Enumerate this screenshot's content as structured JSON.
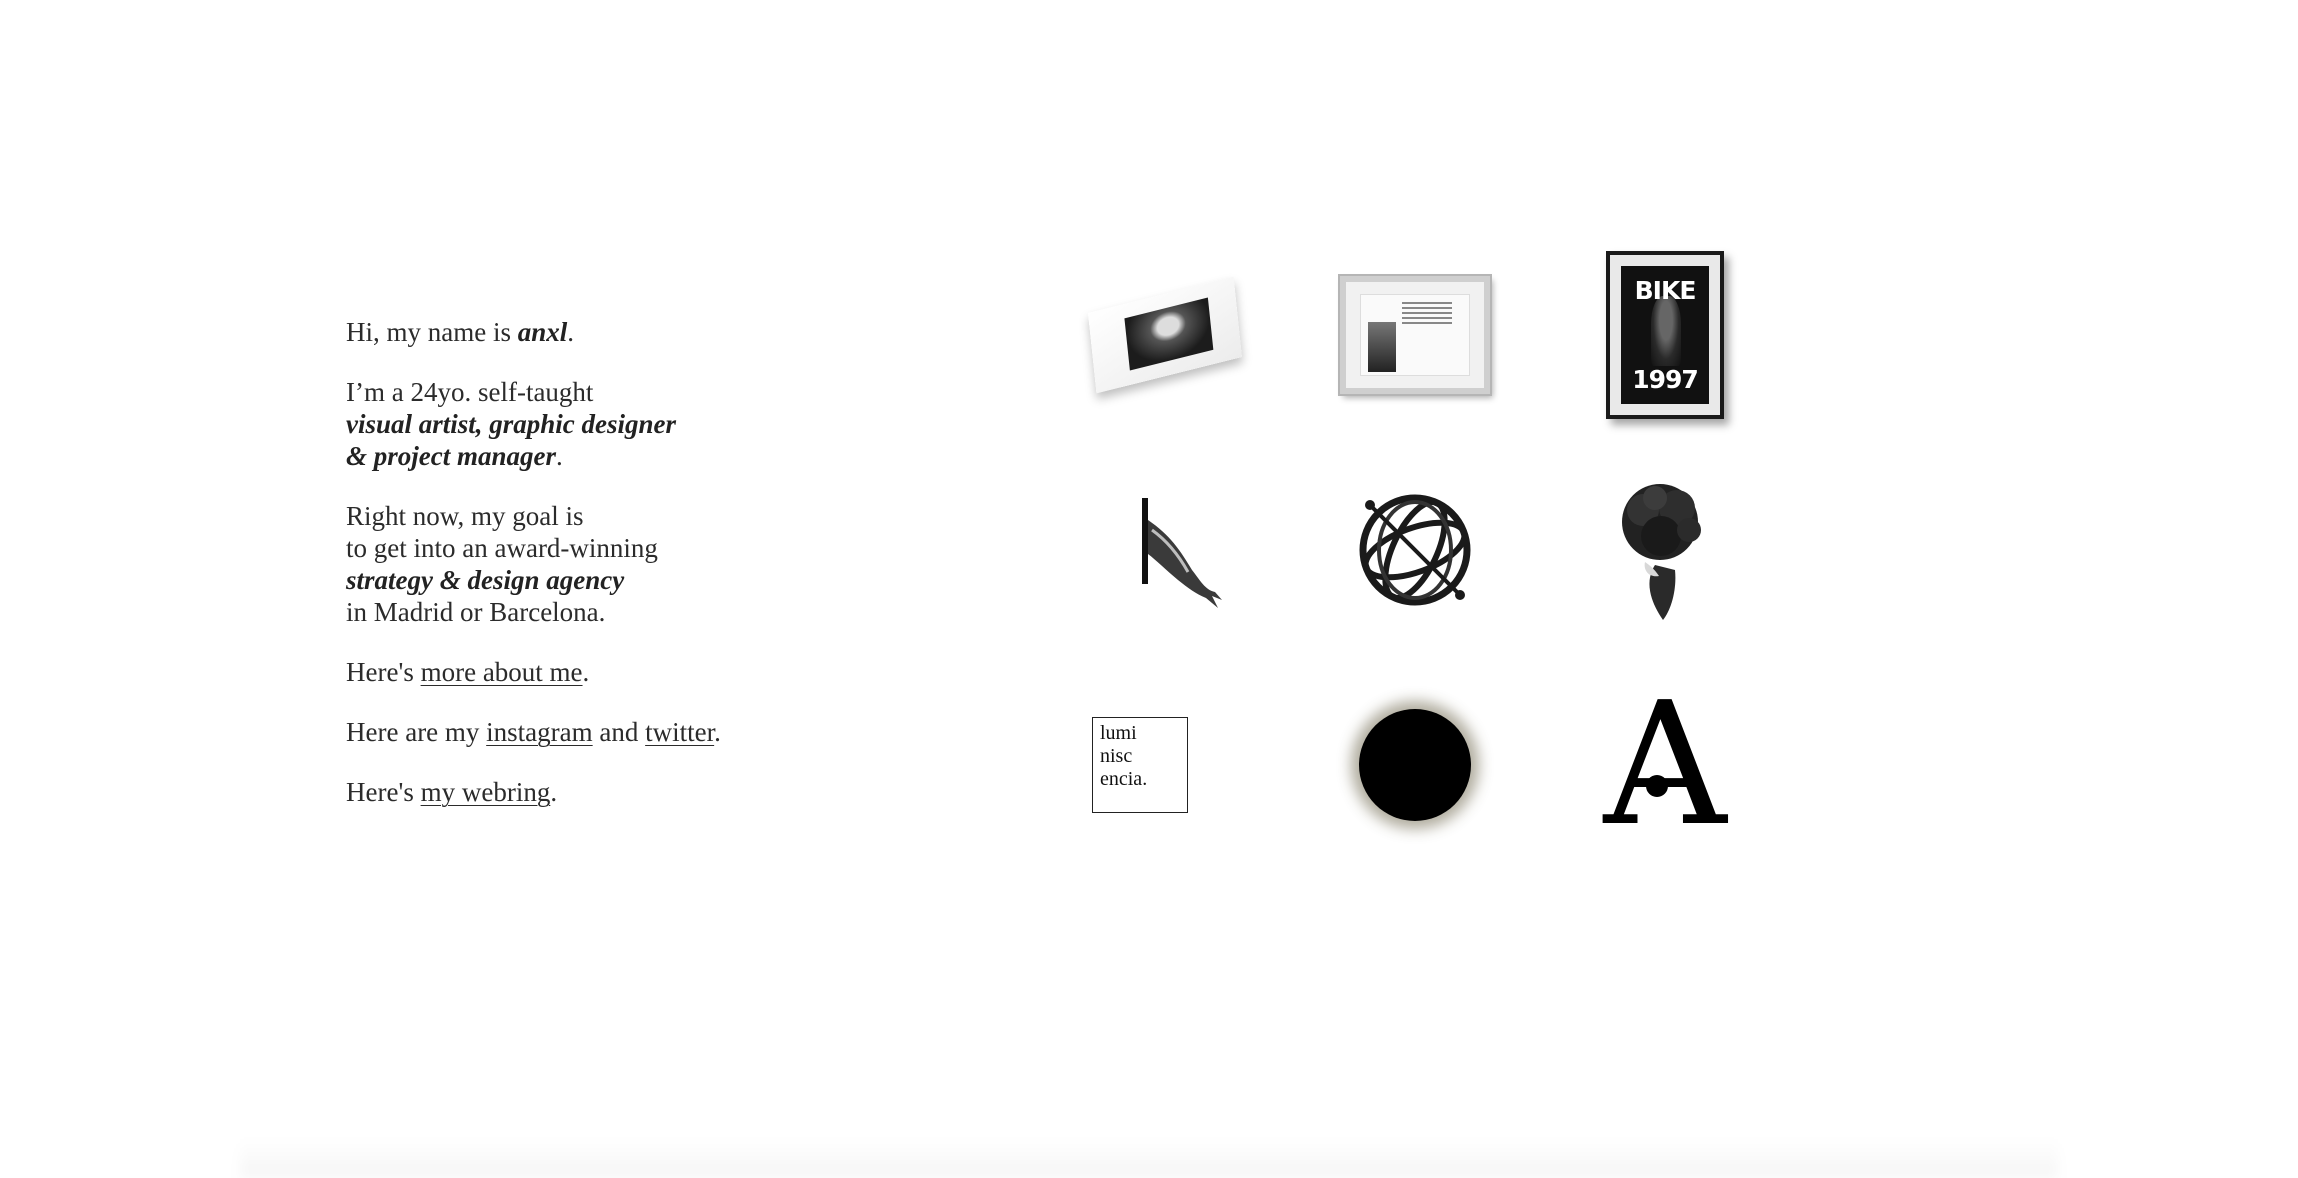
{
  "intro": {
    "greeting_prefix": "Hi, my name is ",
    "name": "anxl",
    "greeting_suffix": ".",
    "about_prefix": "I’m a 24yo. self-taught",
    "role_line1": "visual artist, graphic designer",
    "role_line2": "& project manager",
    "role_suffix": ".",
    "goal_line1": "Right now, my goal is",
    "goal_line2": "to get into an award-winning",
    "goal_emphasis": "strategy & design agency",
    "goal_line3": "in Madrid or Barcelona.",
    "more_prefix": "Here's ",
    "more_link": "more about me",
    "more_suffix": ".",
    "social_prefix": "Here are my ",
    "instagram_link": "instagram",
    "social_and": " and ",
    "twitter_link": "twitter",
    "social_suffix": ".",
    "webring_prefix": "Here's ",
    "webring_link": "my webring",
    "webring_suffix": "."
  },
  "gallery": {
    "items": [
      {
        "id": "print-mockup",
        "icon": "tilted-print"
      },
      {
        "id": "framed-photo",
        "icon": "framed-photo"
      },
      {
        "id": "bike-poster",
        "icon": "framed-poster",
        "line1": "BIKE",
        "line2": "1997"
      },
      {
        "id": "hand-sculpture",
        "icon": "hand"
      },
      {
        "id": "armillary-sphere",
        "icon": "globe"
      },
      {
        "id": "flower-bust",
        "icon": "flower-bust"
      },
      {
        "id": "luminiscencia",
        "icon": "text-box",
        "line1": "lumi",
        "line2": "nisc",
        "line3": "encia."
      },
      {
        "id": "black-orb",
        "icon": "orb"
      },
      {
        "id": "letter-a-logo",
        "icon": "logo-a",
        "letter": "A"
      }
    ]
  },
  "colors": {
    "background": "#ffffff",
    "text": "#2b2b2b",
    "accent": "#000000"
  }
}
